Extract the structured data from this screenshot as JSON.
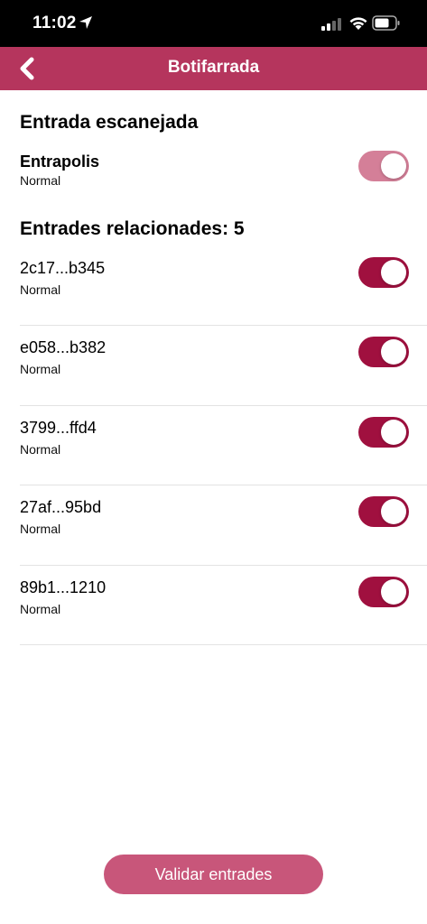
{
  "status_bar": {
    "time": "11:02"
  },
  "header": {
    "title": "Botifarrada"
  },
  "scanned": {
    "heading": "Entrada escanejada",
    "ticket": {
      "name": "Entrapolis",
      "type": "Normal"
    }
  },
  "related": {
    "heading": "Entrades relacionades: 5",
    "items": [
      {
        "code": "2c17...b345",
        "type": "Normal"
      },
      {
        "code": "e058...b382",
        "type": "Normal"
      },
      {
        "code": "3799...ffd4",
        "type": "Normal"
      },
      {
        "code": "27af...95bd",
        "type": "Normal"
      },
      {
        "code": "89b1...1210",
        "type": "Normal"
      }
    ]
  },
  "footer": {
    "validate_label": "Validar entrades"
  },
  "colors": {
    "brand": "#b5355d",
    "toggle_on": "#a0103f",
    "toggle_disabled": "#d47f98",
    "button": "#c8567a"
  }
}
